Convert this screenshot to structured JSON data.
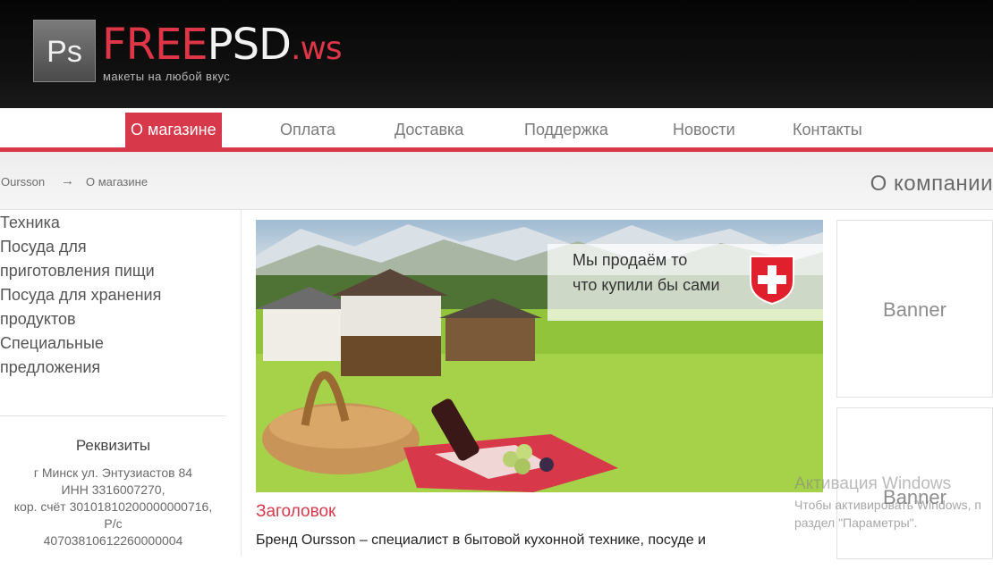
{
  "header": {
    "logo_icon_text": "Ps",
    "brand_part1": "FREE",
    "brand_part2": "PSD",
    "brand_tld": ".ws",
    "tagline": "макеты на любой вкус",
    "colors": {
      "accent": "#d8394a",
      "header_bg": "#0a0a0a"
    }
  },
  "nav": {
    "items": [
      {
        "label": "О магазине",
        "active": true
      },
      {
        "label": "Оплата",
        "active": false
      },
      {
        "label": "Доставка",
        "active": false
      },
      {
        "label": "Поддержка",
        "active": false
      },
      {
        "label": "Новости",
        "active": false
      },
      {
        "label": "Контакты",
        "active": false
      }
    ]
  },
  "breadcrumb": {
    "items": [
      "Oursson",
      "О магазине"
    ],
    "separator": "→"
  },
  "page_heading": "О компании",
  "sidebar": {
    "categories": [
      "Техника",
      "Посуда для",
      "приготовления пищи",
      "Посуда для хранения",
      "продуктов",
      "Специальные",
      "предложения"
    ],
    "requisites_title": "Реквизиты",
    "requisites_lines": [
      "г Минск ул. Энтузиастов 84",
      "ИНН 3316007270,",
      "кор. счёт 30101810200000000716,",
      "Р/с",
      "40703810612260000004"
    ]
  },
  "hero": {
    "overlay_line1": "Мы продаём то",
    "overlay_line2": "что купили бы сами"
  },
  "content": {
    "title": "Заголовок",
    "text": "Бренд Oursson – специалист в бытовой кухонной технике, посуде и"
  },
  "banners": [
    "Banner",
    "Banner"
  ],
  "windows_watermark": {
    "title": "Активация Windows",
    "line1": "Чтобы активировать Windows, п",
    "line2": "раздел \"Параметры\"."
  }
}
